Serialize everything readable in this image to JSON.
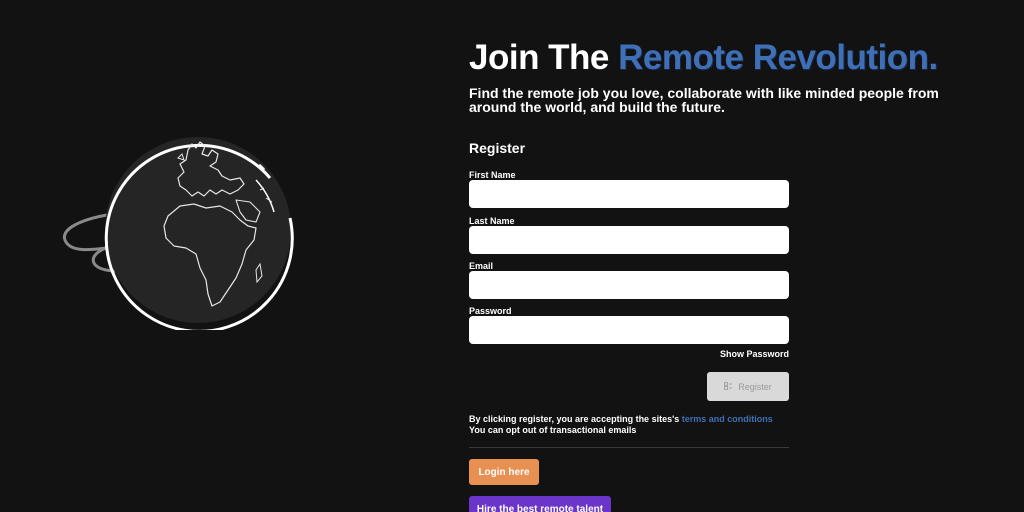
{
  "hero": {
    "headline_part1": "Join The ",
    "headline_part2": "Remote Revolution.",
    "subtitle": "Find the remote job you love, collaborate with like minded people from around the world, and build the future."
  },
  "form": {
    "title": "Register",
    "fields": [
      {
        "label": "First Name",
        "value": "",
        "placeholder": ""
      },
      {
        "label": "Last Name",
        "value": "",
        "placeholder": ""
      },
      {
        "label": "Email",
        "value": "",
        "placeholder": ""
      },
      {
        "label": "Password",
        "value": "",
        "placeholder": ""
      }
    ],
    "show_password_label": "Show Password",
    "register_label": "Register",
    "register_icon": "register-icon",
    "terms_prefix": "By clicking register, you are accepting the sites's ",
    "terms_link": "terms and conditions",
    "terms_suffix": " You can opt out of transactional emails",
    "login_label": "Login here",
    "talent_label": "Hire the best remote talent"
  },
  "illustration": {
    "icon": "globe-icon"
  },
  "colors": {
    "background": "#121212",
    "accent_blue": "#3f6fb4",
    "login_orange": "#e88f52",
    "talent_purple": "#6c35c9",
    "register_disabled": "#d9d9d9"
  }
}
